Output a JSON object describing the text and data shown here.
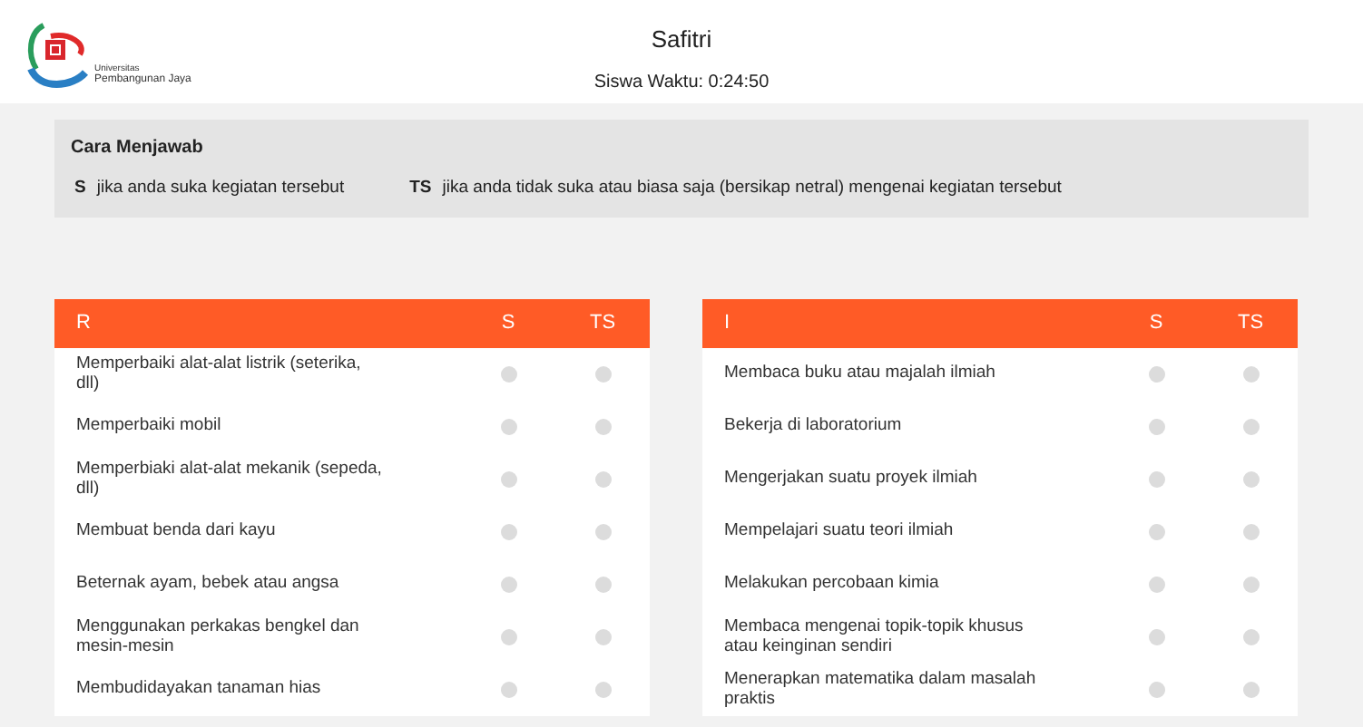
{
  "logo": {
    "line_1": "Universitas",
    "line_2": "Pembangunan Jaya"
  },
  "header": {
    "name": "Safitri",
    "timer": "Siswa Waktu: 0:24:50"
  },
  "instructions": {
    "title": "Cara Menjawab",
    "items": [
      {
        "code": "S",
        "text": "jika anda suka kegiatan tersebut"
      },
      {
        "code": "TS",
        "text": "jika anda tidak suka atau biasa saja (bersikap netral) mengenai kegiatan tersebut"
      }
    ]
  },
  "tables": [
    {
      "columns": [
        "R",
        "S",
        "TS"
      ],
      "rows": [
        {
          "text": "Memperbaiki alat-alat listrik (seterika, dll)",
          "options": [
            {
              "selected": false
            },
            {
              "selected": false
            }
          ]
        },
        {
          "text": "Memperbaiki mobil",
          "options": [
            {
              "selected": false
            },
            {
              "selected": false
            }
          ]
        },
        {
          "text": "Memperbiaki alat-alat mekanik (sepeda, dll)",
          "options": [
            {
              "selected": false
            },
            {
              "selected": false
            }
          ]
        },
        {
          "text": "Membuat benda dari kayu",
          "options": [
            {
              "selected": false
            },
            {
              "selected": false
            }
          ]
        },
        {
          "text": "Beternak ayam, bebek atau angsa",
          "options": [
            {
              "selected": false
            },
            {
              "selected": false
            }
          ]
        },
        {
          "text": "Menggunakan perkakas bengkel dan mesin-mesin",
          "options": [
            {
              "selected": false
            },
            {
              "selected": false
            }
          ]
        },
        {
          "text": "Membudidayakan tanaman hias",
          "options": [
            {
              "selected": false
            },
            {
              "selected": false
            }
          ]
        }
      ]
    },
    {
      "columns": [
        "I",
        "S",
        "TS"
      ],
      "rows": [
        {
          "text": "Membaca buku atau majalah ilmiah",
          "options": [
            {
              "selected": false
            },
            {
              "selected": false
            }
          ]
        },
        {
          "text": "Bekerja di laboratorium",
          "options": [
            {
              "selected": false
            },
            {
              "selected": false
            }
          ]
        },
        {
          "text": "Mengerjakan suatu proyek ilmiah",
          "options": [
            {
              "selected": false
            },
            {
              "selected": false
            }
          ]
        },
        {
          "text": "Mempelajari suatu teori ilmiah",
          "options": [
            {
              "selected": false
            },
            {
              "selected": false
            }
          ]
        },
        {
          "text": "Melakukan percobaan kimia",
          "options": [
            {
              "selected": false
            },
            {
              "selected": false
            }
          ]
        },
        {
          "text": "Membaca mengenai topik-topik khusus atau keinginan sendiri",
          "options": [
            {
              "selected": false
            },
            {
              "selected": false
            }
          ]
        },
        {
          "text": "Menerapkan matematika dalam masalah praktis",
          "options": [
            {
              "selected": false
            },
            {
              "selected": false
            }
          ]
        }
      ]
    }
  ]
}
